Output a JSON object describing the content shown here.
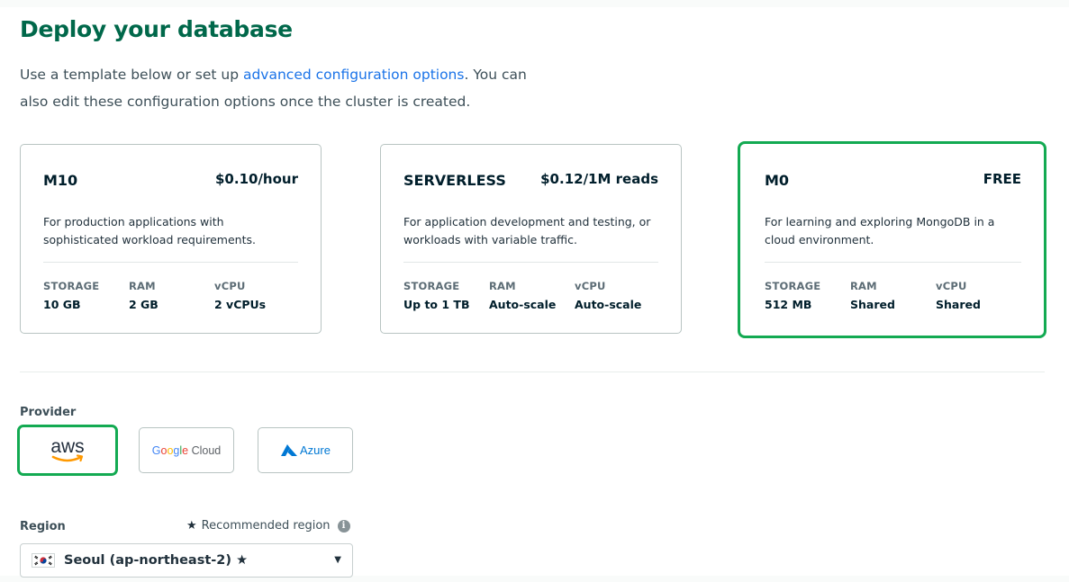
{
  "header": {
    "title": "Deploy your database",
    "subtitle_pre": "Use a template below or set up ",
    "subtitle_link": "advanced configuration options",
    "subtitle_post": ". You can also edit these configuration options once the cluster is created."
  },
  "tiers": [
    {
      "name": "M10",
      "price": "$0.10/hour",
      "description": "For production applications with sophisticated workload requirements.",
      "stats": [
        {
          "label": "STORAGE",
          "value": "10 GB"
        },
        {
          "label": "RAM",
          "value": "2 GB"
        },
        {
          "label": "vCPU",
          "value": "2 vCPUs"
        }
      ],
      "selected": false
    },
    {
      "name": "SERVERLESS",
      "price": "$0.12/1M reads",
      "description": "For application development and testing, or workloads with variable traffic.",
      "stats": [
        {
          "label": "STORAGE",
          "value": "Up to 1 TB"
        },
        {
          "label": "RAM",
          "value": "Auto-scale"
        },
        {
          "label": "vCPU",
          "value": "Auto-scale"
        }
      ],
      "selected": false
    },
    {
      "name": "M0",
      "price": "FREE",
      "description": "For learning and exploring MongoDB in a cloud environment.",
      "stats": [
        {
          "label": "STORAGE",
          "value": "512 MB"
        },
        {
          "label": "RAM",
          "value": "Shared"
        },
        {
          "label": "vCPU",
          "value": "Shared"
        }
      ],
      "selected": true
    }
  ],
  "provider": {
    "label": "Provider",
    "options": [
      {
        "name": "aws",
        "icon": "aws-logo",
        "selected": true
      },
      {
        "name": "Google Cloud",
        "icon": "google-cloud-logo",
        "selected": false
      },
      {
        "name": "Azure",
        "icon": "azure-logo",
        "selected": false
      }
    ]
  },
  "region": {
    "label": "Region",
    "recommended_text": "Recommended region",
    "selected_value": "Seoul (ap-northeast-2)",
    "star": "★",
    "flag": "kr-flag-icon"
  },
  "colors": {
    "accent_green": "#13aa52",
    "title_green": "#00684a",
    "link_blue": "#1a73e8",
    "aws_orange": "#ff9900",
    "azure_blue": "#0078d4"
  }
}
